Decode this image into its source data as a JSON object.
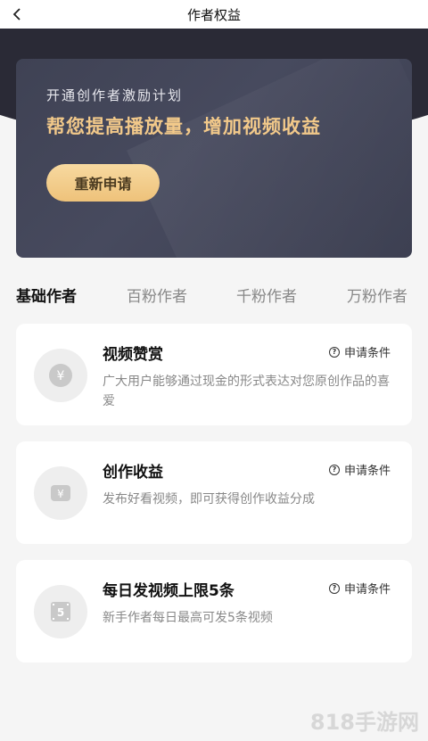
{
  "nav": {
    "title": "作者权益",
    "back_icon": "chevron-left-icon"
  },
  "banner": {
    "subtitle": "开通创作者激励计划",
    "headline": "帮您提高播放量，增加视频收益",
    "button_label": "重新申请",
    "accent_color": "#f2c98a"
  },
  "tabs": [
    {
      "label": "基础作者",
      "active": true
    },
    {
      "label": "百粉作者",
      "active": false
    },
    {
      "label": "千粉作者",
      "active": false
    },
    {
      "label": "万粉作者",
      "active": false
    }
  ],
  "cards": [
    {
      "title": "视频赞赏",
      "condition_label": "申请条件",
      "icon": "yen-coin-icon",
      "description": "广大用户能够通过现金的形式表达对您原创作品的喜爱"
    },
    {
      "title": "创作收益",
      "condition_label": "申请条件",
      "icon": "yen-wallet-icon",
      "description": "发布好看视频，即可获得创作收益分成"
    },
    {
      "title": "每日发视频上限5条",
      "condition_label": "申请条件",
      "icon": "video-five-icon",
      "description": "新手作者每日最高可发5条视频"
    }
  ],
  "watermark": "818手游网"
}
